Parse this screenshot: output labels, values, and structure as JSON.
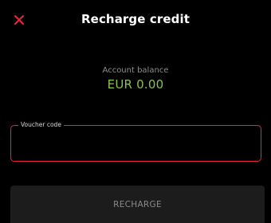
{
  "header": {
    "title": "Recharge credit",
    "close_icon": "close-icon",
    "close_color": "#e8243b"
  },
  "balance": {
    "label": "Account balance",
    "value": "EUR 0.00",
    "value_color": "#8bc34a"
  },
  "voucher": {
    "label": "Voucher code",
    "value": "",
    "border_color": "#e8243b"
  },
  "actions": {
    "recharge_label": "RECHARGE",
    "recharge_enabled": false
  }
}
